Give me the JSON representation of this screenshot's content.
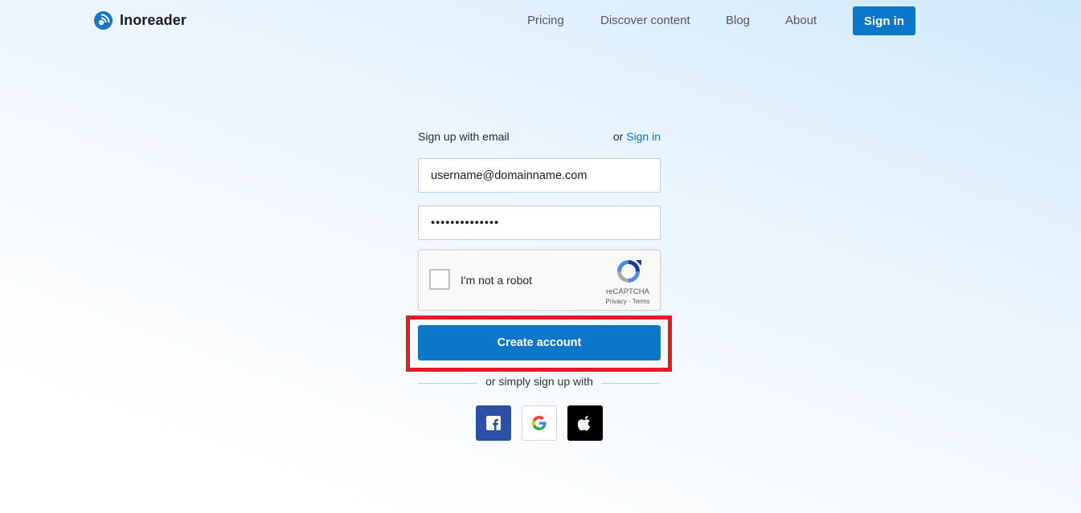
{
  "header": {
    "brand": "Inoreader",
    "nav": [
      "Pricing",
      "Discover content",
      "Blog",
      "About"
    ],
    "signin_label": "Sign in"
  },
  "form": {
    "title": "Sign up with email",
    "or_text": "or",
    "signin_link": "Sign in",
    "email_value": "username@domainname.com",
    "password_value": "••••••••••••••",
    "captcha": {
      "label": "I'm not a robot",
      "brand": "reCAPTCHA",
      "links": "Privacy - Terms"
    },
    "create_label": "Create account",
    "social_divider": "or simply sign up with",
    "social_icons": [
      "facebook-icon",
      "google-icon",
      "apple-icon"
    ]
  },
  "colors": {
    "accent": "#0c77c9",
    "highlight": "#e21b2a",
    "facebook": "#2d4fa6",
    "apple": "#000000"
  }
}
